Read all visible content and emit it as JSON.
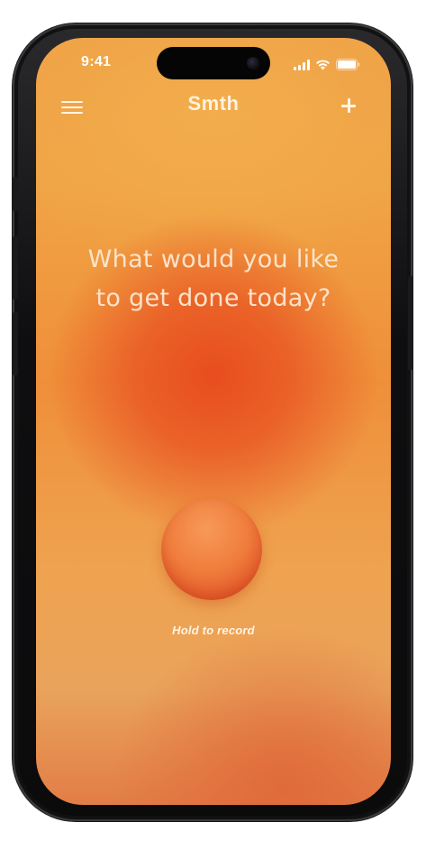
{
  "status_bar": {
    "time": "9:41",
    "icons": [
      "cellular-signal-icon",
      "wifi-icon",
      "battery-icon"
    ]
  },
  "header": {
    "title": "Smth",
    "menu_icon": "hamburger-menu-icon",
    "add_icon": "plus-icon"
  },
  "main": {
    "prompt": "What would you like to get done today?",
    "record_hint": "Hold to record"
  },
  "colors": {
    "background_top": "#efa046",
    "background_center": "#e84d1f",
    "record_button": "#f07e3d",
    "text": "#fbe3c9"
  }
}
